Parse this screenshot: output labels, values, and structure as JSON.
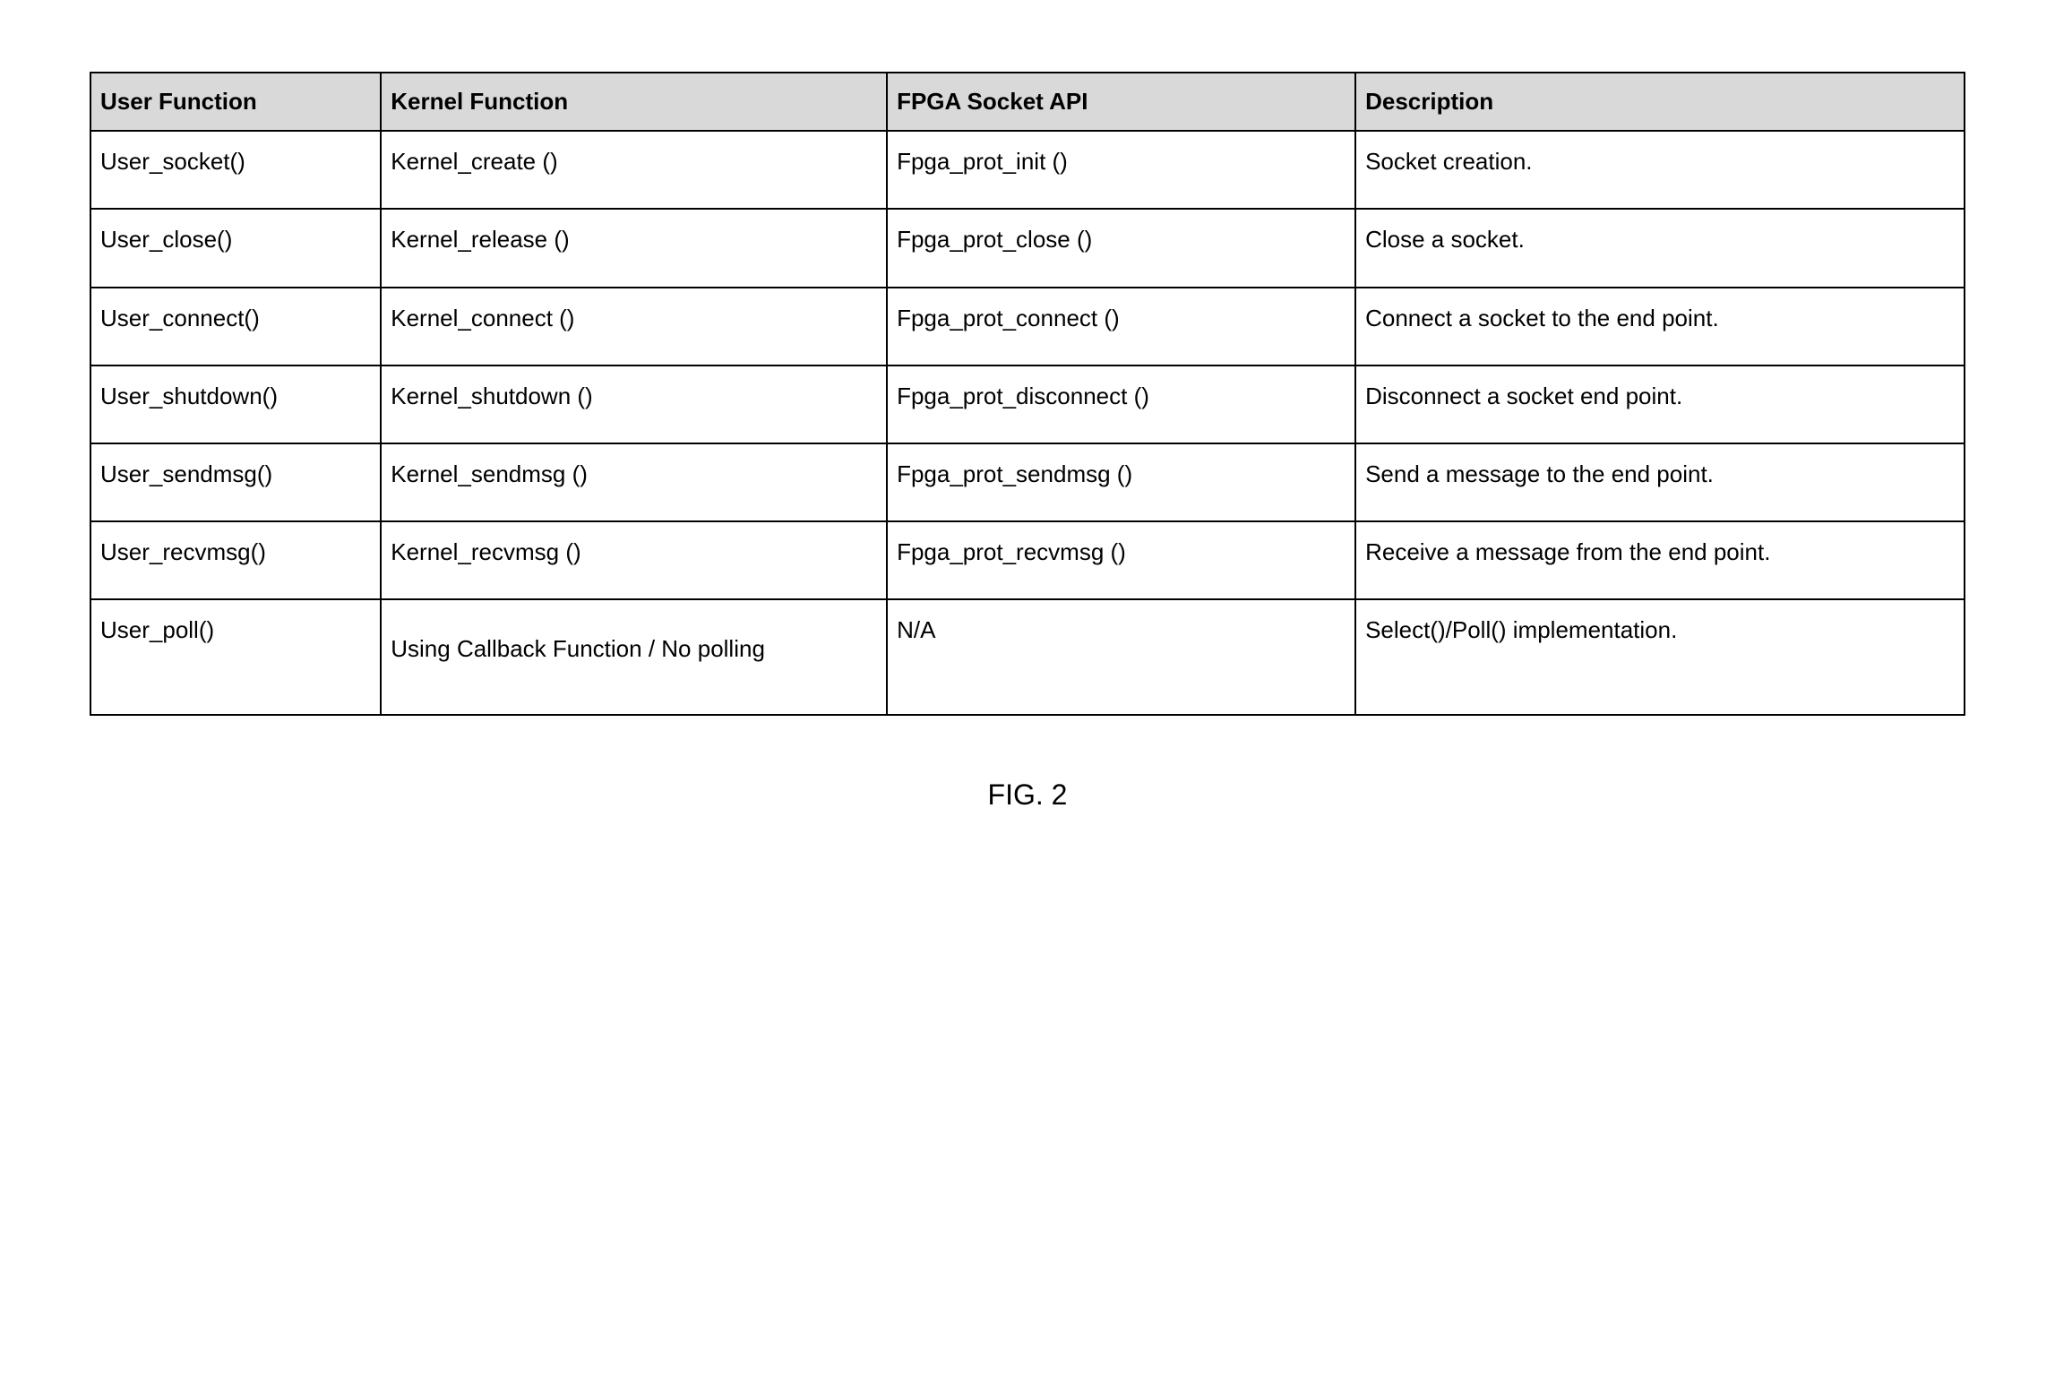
{
  "table": {
    "headers": {
      "user_function": "User Function",
      "kernel_function": "Kernel Function",
      "fpga_socket_api": "FPGA Socket API",
      "description": "Description"
    },
    "rows": [
      {
        "user_function": "User_socket()",
        "kernel_function": "Kernel_create ()",
        "fpga_socket_api": "Fpga_prot_init ()",
        "description": "Socket creation."
      },
      {
        "user_function": "User_close()",
        "kernel_function": "Kernel_release ()",
        "fpga_socket_api": "Fpga_prot_close ()",
        "description": "Close a socket."
      },
      {
        "user_function": "User_connect()",
        "kernel_function": "Kernel_connect ()",
        "fpga_socket_api": "Fpga_prot_connect ()",
        "description": "Connect a socket to the end point."
      },
      {
        "user_function": "User_shutdown()",
        "kernel_function": "Kernel_shutdown ()",
        "fpga_socket_api": "Fpga_prot_disconnect ()",
        "description": "Disconnect a socket end point."
      },
      {
        "user_function": "User_sendmsg()",
        "kernel_function": "Kernel_sendmsg ()",
        "fpga_socket_api": "Fpga_prot_sendmsg ()",
        "description": "Send a message to the end point."
      },
      {
        "user_function": "User_recvmsg()",
        "kernel_function": "Kernel_recvmsg ()",
        "fpga_socket_api": "Fpga_prot_recvmsg ()",
        "description": "Receive a message from the end point."
      },
      {
        "user_function": "User_poll()",
        "kernel_function": "Using Callback Function / No polling",
        "fpga_socket_api": "N/A",
        "description": "Select()/Poll() implementation."
      }
    ]
  },
  "caption": "FIG. 2"
}
